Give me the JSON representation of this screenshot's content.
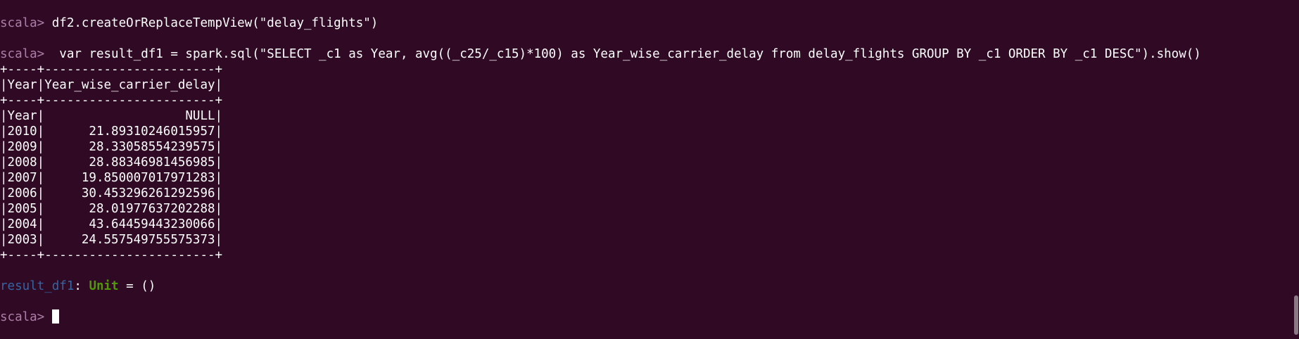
{
  "theme": {
    "background": "#300a24",
    "foreground": "#ffffff",
    "prompt_color": "#ad7fa8",
    "result_name_color": "#3465a4",
    "result_type_color": "#4e9a06"
  },
  "terminal": {
    "prompt": "scala> ",
    "commands": [
      "df2.createOrReplaceTempView(\"delay_flights\")",
      " var result_df1 = spark.sql(\"SELECT _c1 as Year, avg((_c25/_c15)*100) as Year_wise_carrier_delay from delay_flights GROUP BY _c1 ORDER BY _c1 DESC\").show()"
    ],
    "table": {
      "border": "+----+-----------------------+",
      "header": "|Year|Year_wise_carrier_delay|",
      "rows": [
        "|Year|                   NULL|",
        "|2010|      21.89310246015957|",
        "|2009|      28.33058554239575|",
        "|2008|      28.88346981456985|",
        "|2007|     19.850007017971283|",
        "|2006|     30.453296261292596|",
        "|2005|      28.01977637202288|",
        "|2004|      43.64459443230066|",
        "|2003|     24.557549755575373|"
      ]
    },
    "result": {
      "name": "result_df1",
      "separator": ": ",
      "type": "Unit",
      "value": " = ()"
    }
  }
}
